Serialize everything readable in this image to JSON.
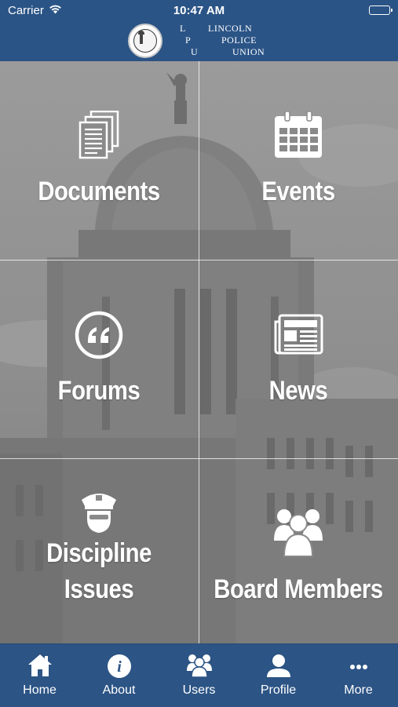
{
  "status_bar": {
    "carrier": "Carrier",
    "time": "10:47 AM"
  },
  "header": {
    "logo_letters": [
      "L",
      "P",
      "U"
    ],
    "logo_words": [
      "LINCOLN",
      "POLICE",
      "UNION"
    ],
    "seal_icon": "lincoln-police-union-seal"
  },
  "tiles": [
    {
      "label": "Documents",
      "icon": "documents-icon"
    },
    {
      "label": "Events",
      "icon": "calendar-icon"
    },
    {
      "label": "Forums",
      "icon": "quote-icon"
    },
    {
      "label": "News",
      "icon": "newspaper-icon"
    },
    {
      "label_line1": "Discipline",
      "label_line2": "Issues",
      "icon": "police-officer-icon"
    },
    {
      "label": "Board Members",
      "icon": "group-icon"
    }
  ],
  "tabbar": {
    "items": [
      {
        "label": "Home",
        "icon": "home-icon"
      },
      {
        "label": "About",
        "icon": "info-icon"
      },
      {
        "label": "Users",
        "icon": "users-icon"
      },
      {
        "label": "Profile",
        "icon": "profile-icon"
      },
      {
        "label": "More",
        "icon": "more-icon"
      }
    ]
  },
  "colors": {
    "brand_blue": "#2c5485",
    "tile_overlay": "#8d8d8d",
    "text": "#ffffff"
  }
}
